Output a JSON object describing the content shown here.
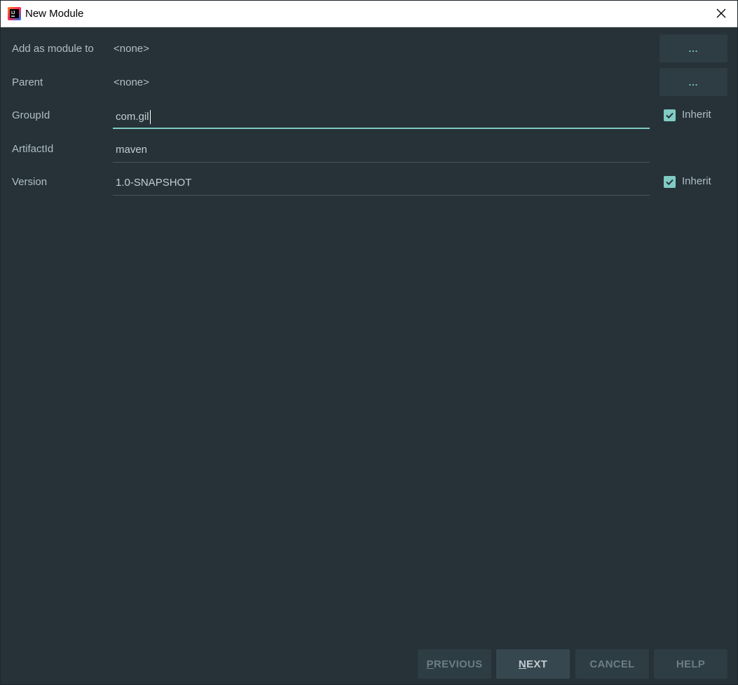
{
  "window": {
    "title": "New Module",
    "app_icon": "intellij-idea-icon",
    "close_icon": "close-icon"
  },
  "form": {
    "add_as_module_to": {
      "label": "Add as module to",
      "value": "<none>",
      "browse_label": "..."
    },
    "parent": {
      "label": "Parent",
      "value": "<none>",
      "browse_label": "..."
    },
    "group_id": {
      "label": "GroupId",
      "value": "com.gil",
      "inherit_label": "Inherit",
      "inherit_checked": true
    },
    "artifact_id": {
      "label": "ArtifactId",
      "value": "maven"
    },
    "version": {
      "label": "Version",
      "value": "1.0-SNAPSHOT",
      "inherit_label": "Inherit",
      "inherit_checked": true
    }
  },
  "footer": {
    "previous": {
      "mnemonic": "P",
      "rest": "REVIOUS"
    },
    "next": {
      "mnemonic": "N",
      "rest": "EXT"
    },
    "cancel": "CANCEL",
    "help": "HELP"
  },
  "colors": {
    "background": "#263238",
    "accent": "#80cbc4",
    "text": "#b0bec5",
    "button": "#2e3c43"
  }
}
